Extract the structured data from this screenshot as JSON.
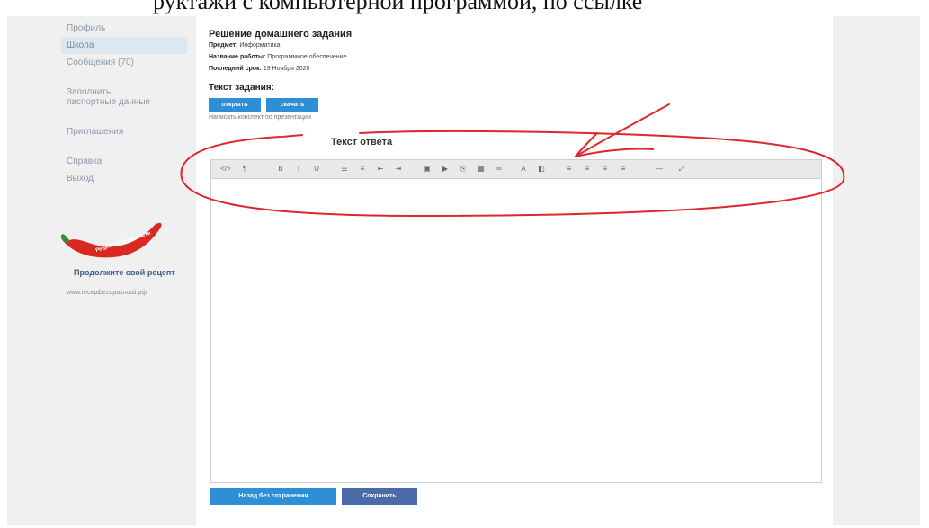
{
  "caption": "руктажи с компьютерной программой, по ссылке",
  "sidebar": {
    "items": [
      {
        "label": "Профиль",
        "active": false
      },
      {
        "label": "Школа",
        "active": true
      },
      {
        "label": "Сообщения  (70)",
        "active": false
      },
      {
        "label": "Заполнить паспортные данные",
        "active": false
      },
      {
        "label": "Приглашения",
        "active": false
      },
      {
        "label": "Справка",
        "active": false
      },
      {
        "label": "Выход",
        "active": false
      }
    ],
    "logo_text": "Рецепт Безопасности",
    "promo_link": "Продолжите свой рецепт",
    "promo_url": "www.receptbezopasnosti.рф"
  },
  "main": {
    "title": "Решение домашнего задания",
    "subject_label": "Предмет:",
    "subject_value": "Информатика",
    "work_label": "Название работы:",
    "work_value": "Программное обеспечение",
    "deadline_label": "Последний срок:",
    "deadline_value": "19 Ноября 2020",
    "task_title": "Текст задания:",
    "btn_open": "открыть",
    "btn_download": "скачать",
    "task_hint": "Написать конспект по презентации",
    "answer_title": "Текст ответа",
    "btn_back": "Назад без сохранения",
    "btn_save": "Сохранить"
  },
  "toolbar": {
    "icons": [
      "code-icon",
      "paragraph-icon",
      "bold-icon",
      "italic-icon",
      "underline-icon",
      "unordered-list-icon",
      "ordered-list-icon",
      "outdent-icon",
      "indent-icon",
      "image-icon",
      "video-icon",
      "file-icon",
      "table-icon",
      "link-icon",
      "font-color-icon",
      "background-color-icon",
      "align-left-icon",
      "align-center-icon",
      "align-right-icon",
      "align-justify-icon",
      "horizontal-rule-icon",
      "fullscreen-icon"
    ],
    "glyphs": [
      "</>",
      "¶",
      "B",
      "I",
      "U",
      "☰",
      "≡",
      "⇤",
      "⇥",
      "▣",
      "▶",
      "⎘",
      "▦",
      "∞",
      "A",
      "◧",
      "≡",
      "≡",
      "≡",
      "≡",
      "—",
      "⤢"
    ]
  },
  "colors": {
    "accent": "#2f8fd6",
    "save_button": "#4a6aa8",
    "annotation": "#e0262a",
    "sidebar_active": "#dde7f0"
  }
}
